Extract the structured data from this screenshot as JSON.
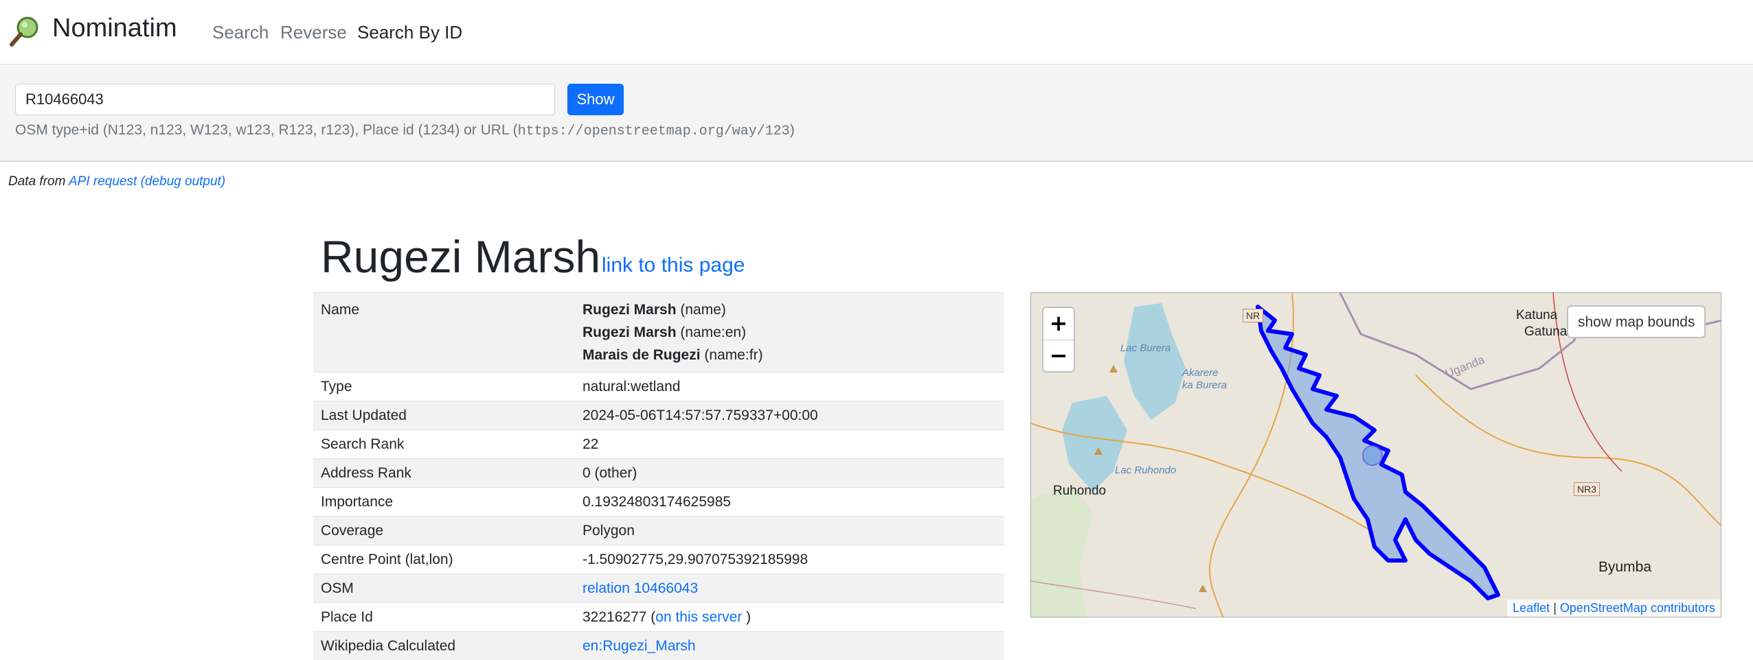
{
  "navbar": {
    "brand": "Nominatim",
    "links": [
      {
        "label": "Search",
        "active": false
      },
      {
        "label": "Reverse",
        "active": false
      },
      {
        "label": "Search By ID",
        "active": true
      }
    ]
  },
  "search": {
    "value": "R10466043",
    "button": "Show",
    "hint_prefix": "OSM type+id (N123, n123, W123, w123, R123, r123), Place id (1234) or URL (",
    "hint_url": "https://openstreetmap.org/way/123",
    "hint_suffix": ")"
  },
  "data_from": {
    "prefix": "Data from ",
    "api_link": "API request",
    "debug_link": "(debug output)"
  },
  "title": "Rugezi Marsh",
  "title_link": "link to this page",
  "details": {
    "names": [
      {
        "value": "Rugezi Marsh",
        "tag": "(name)"
      },
      {
        "value": "Rugezi Marsh",
        "tag": "(name:en)"
      },
      {
        "value": "Marais de Rugezi",
        "tag": "(name:fr)"
      }
    ],
    "rows": {
      "name_label": "Name",
      "type_label": "Type",
      "type_value": "natural:wetland",
      "updated_label": "Last Updated",
      "updated_value": "2024-05-06T14:57:57.759337+00:00",
      "search_rank_label": "Search Rank",
      "search_rank_value": "22",
      "address_rank_label": "Address Rank",
      "address_rank_value": "0 (other)",
      "importance_label": "Importance",
      "importance_value": "0.19324803174625985",
      "coverage_label": "Coverage",
      "coverage_value": "Polygon",
      "centre_label": "Centre Point (lat,lon)",
      "centre_value": "-1.50902775,29.907075392185998",
      "osm_label": "OSM",
      "osm_value": "relation 10466043",
      "place_id_label": "Place Id",
      "place_id_value": "32216277",
      "place_id_open": " (",
      "place_id_link": "on this server",
      "place_id_close": " )",
      "wikipedia_label": "Wikipedia Calculated",
      "wikipedia_value": "en:Rugezi_Marsh"
    }
  },
  "map": {
    "zoom_in": "+",
    "zoom_out": "−",
    "show_bounds": "show map bounds",
    "attribution_leaflet": "Leaflet",
    "attribution_sep": " | ",
    "attribution_osm": "OpenStreetMap contributors",
    "labels": {
      "katuna": "Katuna",
      "gatuna": "Gatuna",
      "uganda": "Uganda",
      "lac_burera": "Lac Burera",
      "akarere": "Akarere",
      "ka_burera": "ka Burera",
      "lac_ruhondo": "Lac Ruhondo",
      "ruhondo": "Ruhondo",
      "byumba": "Byumba",
      "nr3": "NR3",
      "nr_partial": "NR"
    },
    "colors": {
      "outline": "#0000ff",
      "fill": "#7aa6e6",
      "water": "#aad3df"
    }
  }
}
